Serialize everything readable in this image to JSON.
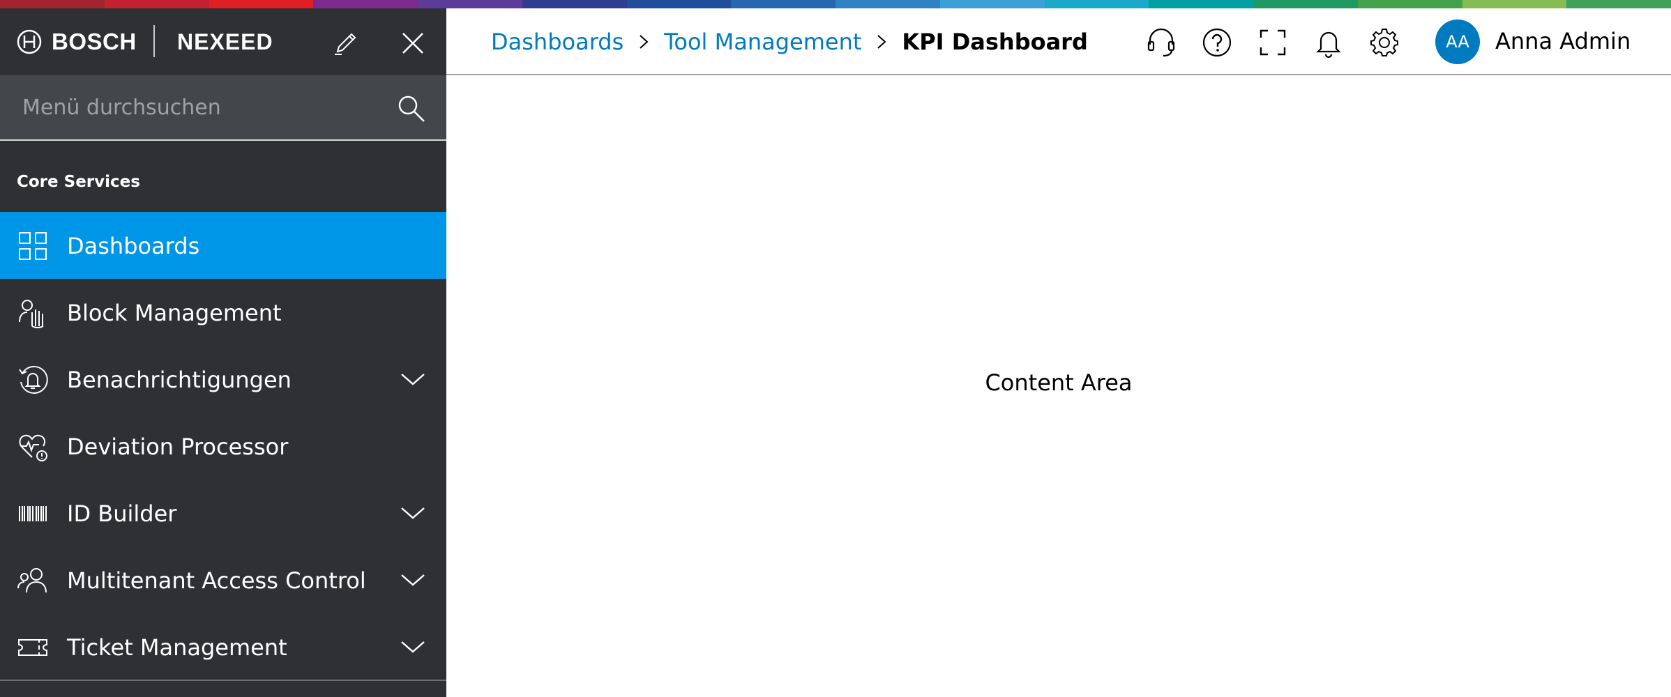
{
  "brand": {
    "company": "BOSCH",
    "product": "NEXEED",
    "stripe_colors": [
      "#a2242f",
      "#c42032",
      "#e01f25",
      "#7d2a8c",
      "#5c3b9a",
      "#2f3c8f",
      "#1f4f9c",
      "#2567b0",
      "#2f82c4",
      "#3aa0d6",
      "#1aa9c8",
      "#00a0a4",
      "#1e9a62",
      "#43a34a",
      "#86bd52",
      "#3ea25a"
    ]
  },
  "sidebar": {
    "search_placeholder": "Menü durchsuchen",
    "section_title": "Core Services",
    "items": [
      {
        "label": "Dashboards",
        "icon": "dashboard-grid-icon",
        "active": true,
        "expandable": false
      },
      {
        "label": "Block Management",
        "icon": "hand-stop-icon",
        "active": false,
        "expandable": false
      },
      {
        "label": "Benachrichtigungen",
        "icon": "bell-cycle-icon",
        "active": false,
        "expandable": true
      },
      {
        "label": "Deviation Processor",
        "icon": "heart-pulse-icon",
        "active": false,
        "expandable": false
      },
      {
        "label": "ID Builder",
        "icon": "barcode-icon",
        "active": false,
        "expandable": true
      },
      {
        "label": "Multitenant Access Control",
        "icon": "users-icon",
        "active": false,
        "expandable": true
      },
      {
        "label": "Ticket Management",
        "icon": "ticket-icon",
        "active": false,
        "expandable": true
      }
    ]
  },
  "header": {
    "breadcrumb": [
      "Dashboards",
      "Tool Management"
    ],
    "current_page": "KPI Dashboard",
    "icons": [
      "headset-icon",
      "help-icon",
      "fullscreen-icon",
      "notification-bell-icon",
      "settings-gear-icon"
    ],
    "user": {
      "initials": "AA",
      "name": "Anna Admin"
    }
  },
  "content": {
    "label": "Content Area"
  },
  "colors": {
    "sidebar_bg": "#2e3034",
    "active_item": "#0096e8",
    "link": "#007bc0",
    "avatar": "#007bc0"
  }
}
